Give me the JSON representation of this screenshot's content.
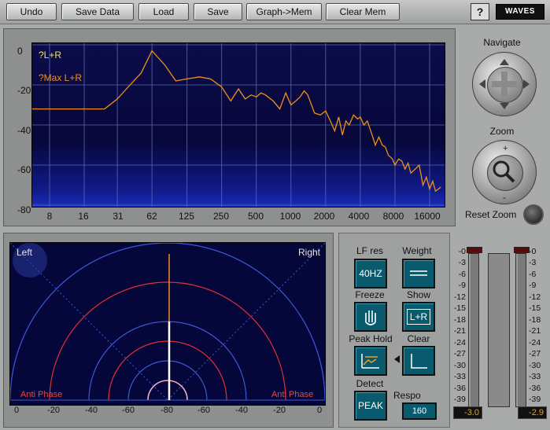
{
  "toolbar": {
    "buttons": [
      "Undo",
      "Save Data",
      "Load",
      "Save",
      "Graph->Mem",
      "Clear Mem"
    ],
    "help": "?",
    "logo": "WAVES"
  },
  "spectrum": {
    "y_ticks": [
      "0",
      "-20",
      "-40",
      "-60",
      "-80"
    ],
    "x_ticks": [
      "8",
      "16",
      "31",
      "62",
      "125",
      "250",
      "500",
      "1000",
      "2000",
      "4000",
      "8000",
      "16000"
    ],
    "legend_current": "?L+R",
    "legend_max": "?Max L+R"
  },
  "chart_data": {
    "type": "line",
    "xlabel": "",
    "ylabel": "",
    "xscale": "log",
    "ylim": [
      -80,
      0
    ],
    "series": [
      {
        "name": "Max L+R",
        "x": [
          4,
          8,
          16,
          24,
          31,
          40,
          50,
          62,
          80,
          100,
          125,
          160,
          200,
          250,
          300,
          350,
          400,
          450,
          500,
          550,
          600,
          700,
          800,
          900,
          1000,
          1100,
          1200,
          1300,
          1400,
          1600,
          1800,
          2000,
          2200,
          2400,
          2600,
          2800,
          3000,
          3200,
          3500,
          3800,
          4000,
          4300,
          4600,
          5000,
          5400,
          5800,
          6200,
          6600,
          7000,
          7600,
          8000,
          8600,
          9200,
          9800,
          10400,
          11000,
          12000,
          13000,
          14000,
          15000,
          16000,
          17000,
          18000,
          19000,
          20000
        ],
        "y": [
          -32,
          -32,
          -32,
          -32,
          -27,
          -20,
          -14,
          -3,
          -10,
          -18,
          -17,
          -16,
          -17,
          -21,
          -28,
          -22,
          -27,
          -25,
          -26,
          -24,
          -25,
          -28,
          -32,
          -24,
          -30,
          -28,
          -26,
          -23,
          -25,
          -34,
          -35,
          -33,
          -38,
          -43,
          -36,
          -45,
          -38,
          -40,
          -35,
          -37,
          -36,
          -40,
          -38,
          -44,
          -50,
          -46,
          -50,
          -51,
          -55,
          -57,
          -60,
          -57,
          -58,
          -62,
          -59,
          -64,
          -62,
          -60,
          -70,
          -66,
          -72,
          -68,
          -73,
          -72,
          -71
        ]
      }
    ]
  },
  "navigate": {
    "title": "Navigate"
  },
  "zoom": {
    "title": "Zoom",
    "reset_label": "Reset Zoom"
  },
  "scope": {
    "left_label": "Left",
    "right_label": "Right",
    "anti_phase_left": "Anti Phase",
    "anti_phase_right": "Anti Phase",
    "x_ticks": [
      "0",
      "-20",
      "-40",
      "-60",
      "-80",
      "-60",
      "-40",
      "-20",
      "0"
    ]
  },
  "controls": {
    "lf_res_label": "LF res",
    "lf_res_value": "40HZ",
    "weight_label": "Weight",
    "freeze_label": "Freeze",
    "show_label": "Show",
    "show_value": "L+R",
    "peak_hold_label": "Peak Hold",
    "clear_label": "Clear",
    "detect_label": "Detect",
    "detect_value": "PEAK",
    "response_label": "Respo",
    "response_value": "160"
  },
  "meters": {
    "scale": [
      "-0",
      "-3",
      "-6",
      "-9",
      "-12",
      "-15",
      "-18",
      "-21",
      "-24",
      "-27",
      "-30",
      "-33",
      "-36",
      "-39"
    ],
    "readout_left": "-3.0",
    "readout_right": "-2.9"
  },
  "colors": {
    "background": "#a9aaaa",
    "spectrum_bg": "#0b0c4a",
    "trace": "#f09018",
    "legend_current": "#f0e26a",
    "scope_bg": "#05063a",
    "scope_grid": "#3a5ad8",
    "anti_phase": "#e04a4a",
    "control_button": "#0a5a6e",
    "meter_readout": "#e8a020"
  }
}
